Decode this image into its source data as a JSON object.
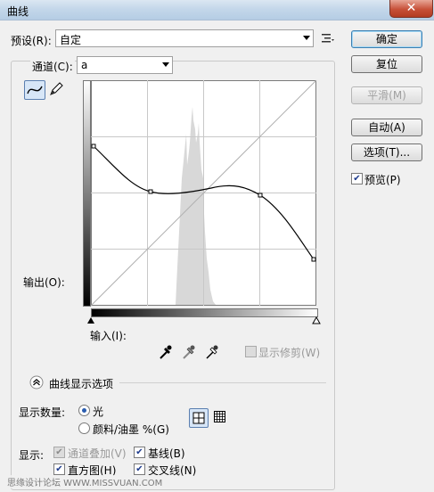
{
  "window": {
    "title": "曲线",
    "close_glyph": "✕"
  },
  "preset": {
    "label": "预设(R):",
    "value": "自定"
  },
  "channel": {
    "label": "通道(C):",
    "value": "a"
  },
  "buttons": {
    "ok": "确定",
    "reset": "复位",
    "smooth": "平滑(M)",
    "auto": "自动(A)",
    "options": "选项(T)..."
  },
  "preview": {
    "label": "预览(P)",
    "checked": true
  },
  "graph": {
    "output_label": "输出(O):",
    "input_label": "输入(I):",
    "show_clipping": "显示修剪(W)"
  },
  "display_options": {
    "section_label": "曲线显示选项",
    "amount_label": "显示数量:",
    "amount_options": [
      "光",
      "颜料/油墨 %(G)"
    ],
    "amount_selected": 0,
    "show_label": "显示:",
    "checks": [
      {
        "label": "通道叠加(V)",
        "checked": true,
        "disabled": true
      },
      {
        "label": "基线(B)",
        "checked": true,
        "disabled": false
      },
      {
        "label": "直方图(H)",
        "checked": true,
        "disabled": false
      },
      {
        "label": "交叉线(N)",
        "checked": true,
        "disabled": false
      }
    ]
  },
  "watermark": "思缘设计论坛 WWW.MISSVUAN.COM",
  "icons": [
    "curve-tool-icon",
    "pencil-icon",
    "preset-menu-icon",
    "black-eyedropper-icon",
    "gray-eyedropper-icon",
    "white-eyedropper-icon",
    "grid-4-icon",
    "grid-10-icon",
    "collapse-chevron-icon"
  ]
}
